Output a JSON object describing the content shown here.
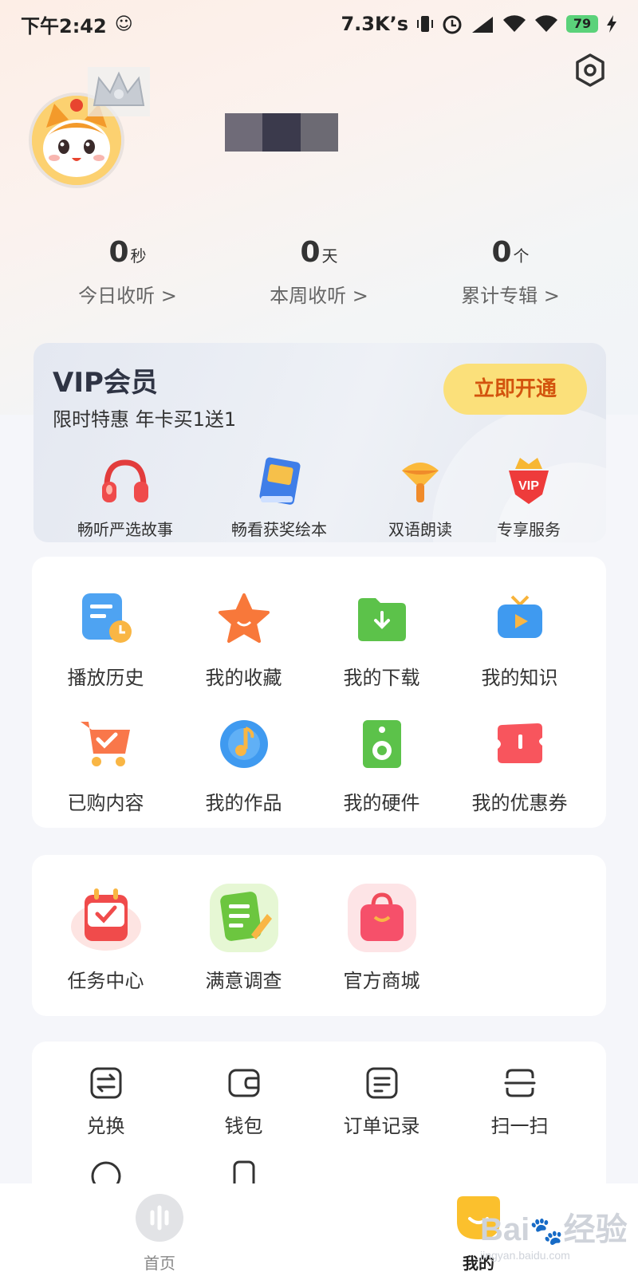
{
  "status_bar": {
    "time": "下午2:42",
    "network_speed": "7.3K’s",
    "battery": "79"
  },
  "profile": {
    "avatar_alt": "cat-avatar"
  },
  "stats": [
    {
      "num": "0",
      "unit": "秒",
      "label": "今日收听 >"
    },
    {
      "num": "0",
      "unit": "天",
      "label": "本周收听 >"
    },
    {
      "num": "0",
      "unit": "个",
      "label": "累计专辑 >"
    }
  ],
  "vip": {
    "title": "VIP会员",
    "subtitle": "限时特惠 年卡买1送1",
    "button": "立即开通",
    "perks": [
      {
        "label": "畅听严选故事",
        "icon": "headphones-icon"
      },
      {
        "label": "畅看获奖绘本",
        "icon": "picture-book-icon"
      },
      {
        "label": "双语朗读",
        "icon": "microphone-icon"
      },
      {
        "label": "专享服务",
        "icon": "vip-crown-icon"
      }
    ]
  },
  "features": [
    {
      "label": "播放历史",
      "icon": "history-icon"
    },
    {
      "label": "我的收藏",
      "icon": "star-icon"
    },
    {
      "label": "我的下载",
      "icon": "download-folder-icon"
    },
    {
      "label": "我的知识",
      "icon": "tv-play-icon"
    },
    {
      "label": "已购内容",
      "icon": "cart-icon"
    },
    {
      "label": "我的作品",
      "icon": "music-disc-icon"
    },
    {
      "label": "我的硬件",
      "icon": "speaker-icon"
    },
    {
      "label": "我的优惠券",
      "icon": "coupon-icon"
    }
  ],
  "services": [
    {
      "label": "任务中心",
      "icon": "calendar-check-icon"
    },
    {
      "label": "满意调查",
      "icon": "survey-icon"
    },
    {
      "label": "官方商城",
      "icon": "shopping-bag-icon"
    }
  ],
  "tools": [
    {
      "label": "兑换",
      "icon": "exchange-icon"
    },
    {
      "label": "钱包",
      "icon": "wallet-icon"
    },
    {
      "label": "订单记录",
      "icon": "order-icon"
    },
    {
      "label": "扫一扫",
      "icon": "scan-icon"
    }
  ],
  "tabbar": [
    {
      "label": "首页",
      "icon": "home-sound-icon"
    },
    {
      "label": "我的",
      "icon": "me-icon"
    }
  ],
  "watermark": {
    "brand": "Bai",
    "brand_cn": "经验",
    "url": "jingyan.baidu.com"
  }
}
